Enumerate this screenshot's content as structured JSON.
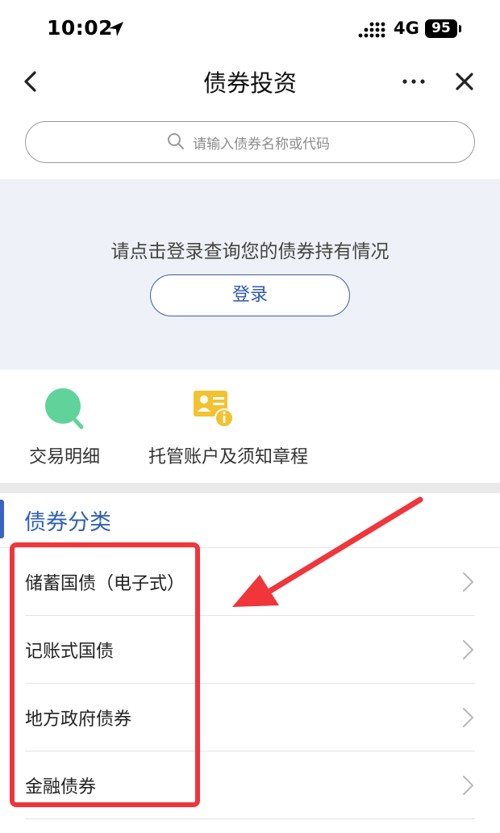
{
  "status_bar": {
    "time": "10:02",
    "network": "4G",
    "battery": "95",
    "icons": [
      "location-arrow-icon",
      "signal-icon",
      "battery-icon"
    ]
  },
  "nav": {
    "title": "债券投资",
    "icons": [
      "chevron-left-icon",
      "more-icon",
      "close-icon"
    ]
  },
  "search": {
    "placeholder": "请输入债券名称或代码",
    "icon": "search-icon"
  },
  "login": {
    "prompt": "请点击登录查询您的债券持有情况",
    "button_label": "登录"
  },
  "shortcuts": [
    {
      "label": "交易明细",
      "icon": "magnifier-icon"
    },
    {
      "label": "托管账户及须知章程",
      "icon": "account-card-info-icon"
    }
  ],
  "category": {
    "title": "债券分类",
    "items": [
      {
        "label": "储蓄国债（电子式）"
      },
      {
        "label": "记账式国债"
      },
      {
        "label": "地方政府债券"
      },
      {
        "label": "金融债券"
      }
    ]
  },
  "colors": {
    "accent": "#3a62c2",
    "login_bg": "#eef2f8",
    "trade_icon": "#5fd39a",
    "custody_icon": "#f2c230",
    "annotation": "#f0353b"
  }
}
